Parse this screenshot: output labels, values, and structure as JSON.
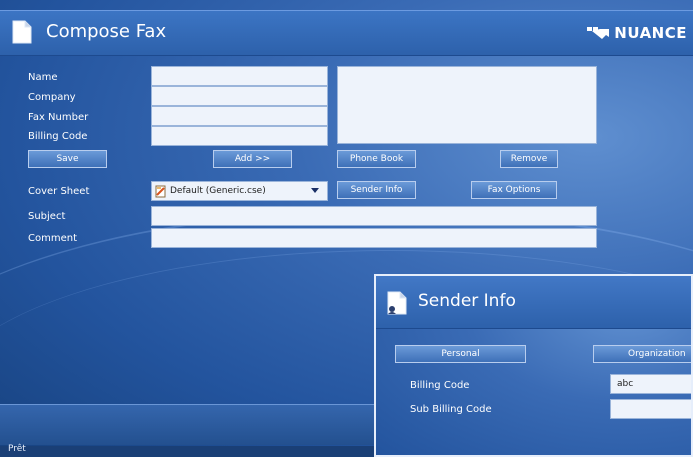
{
  "compose": {
    "title": "Compose Fax",
    "logo": "NUANCE",
    "labels": {
      "name": "Name",
      "company": "Company",
      "fax_number": "Fax Number",
      "billing_code": "Billing Code",
      "cover_sheet": "Cover Sheet",
      "subject": "Subject",
      "comment": "Comment"
    },
    "fields": {
      "name": "",
      "company": "",
      "fax_number": "",
      "billing_code": "",
      "subject": "",
      "comment": ""
    },
    "buttons": {
      "save": "Save",
      "add": "Add >>",
      "phone_book": "Phone Book",
      "remove": "Remove",
      "sender_info": "Sender Info",
      "fax_options": "Fax Options"
    },
    "cover_sheet_value": "Default (Generic.cse)",
    "recipients": []
  },
  "status": {
    "text": "Prêt"
  },
  "sender_info": {
    "title": "Sender Info",
    "buttons": {
      "personal": "Personal",
      "organization": "Organization"
    },
    "labels": {
      "billing_code": "Billing Code",
      "sub_billing_code": "Sub Billing Code"
    },
    "fields": {
      "billing_code": "abc",
      "sub_billing_code": ""
    }
  },
  "colors": {
    "accent": "#2d61ab",
    "background": "#23549e",
    "field": "#eef3fb"
  }
}
